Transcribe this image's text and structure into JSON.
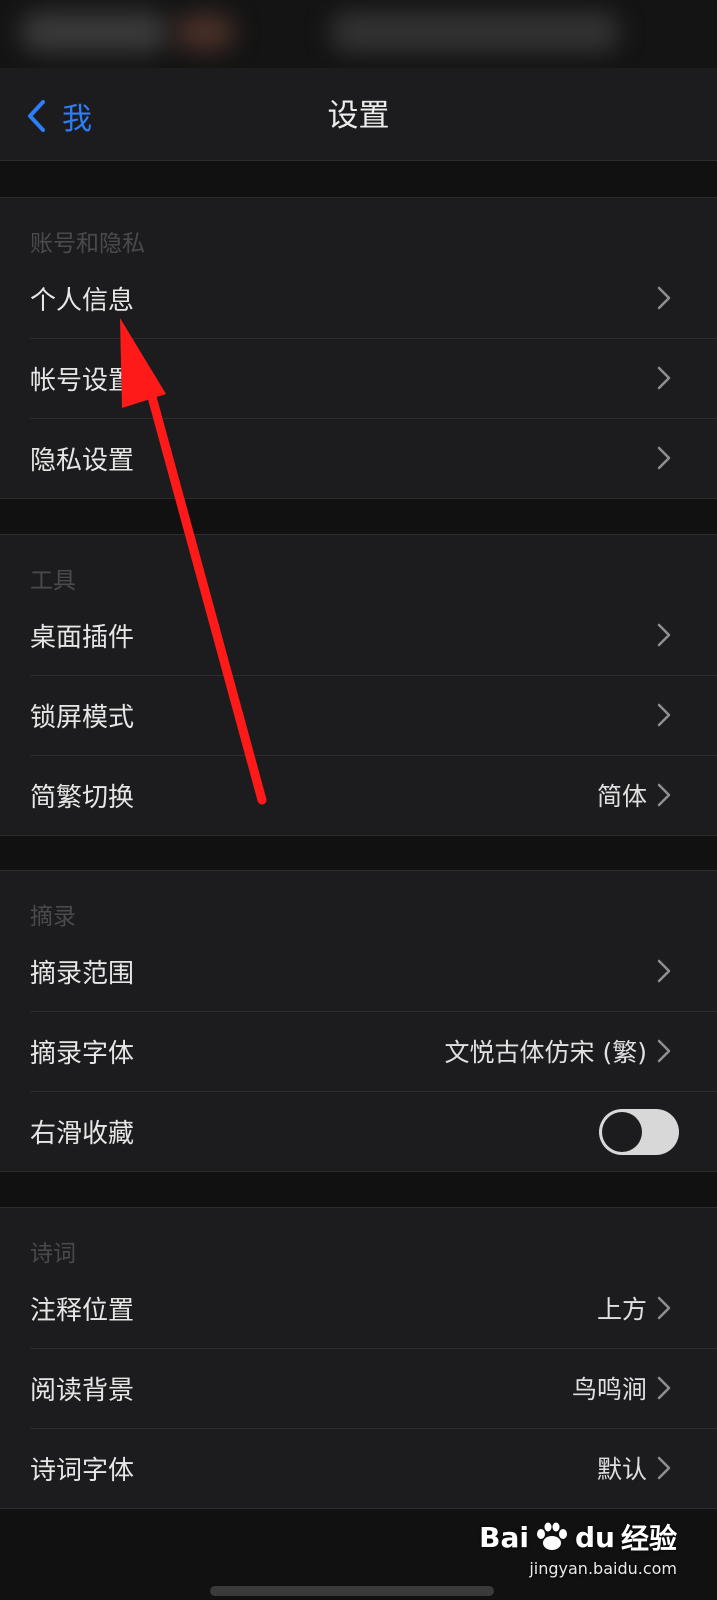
{
  "navbar": {
    "back_label": "我",
    "title": "设置"
  },
  "groups": [
    {
      "header": "账号和隐私",
      "rows": [
        {
          "label": "个人信息",
          "value": ""
        },
        {
          "label": "帐号设置",
          "value": ""
        },
        {
          "label": "隐私设置",
          "value": ""
        }
      ]
    },
    {
      "header": "工具",
      "rows": [
        {
          "label": "桌面插件",
          "value": ""
        },
        {
          "label": "锁屏模式",
          "value": ""
        },
        {
          "label": "简繁切换",
          "value": "简体"
        }
      ]
    },
    {
      "header": "摘录",
      "rows": [
        {
          "label": "摘录范围",
          "value": ""
        },
        {
          "label": "摘录字体",
          "value": "文悦古体仿宋 (繁)"
        },
        {
          "label": "右滑收藏",
          "toggle": "off"
        }
      ]
    },
    {
      "header": "诗词",
      "rows": [
        {
          "label": "注释位置",
          "value": "上方"
        },
        {
          "label": "阅读背景",
          "value": "鸟鸣涧"
        },
        {
          "label": "诗词字体",
          "value": "默认"
        }
      ]
    }
  ],
  "watermark": {
    "brand_left": "Bai",
    "brand_mid": "du",
    "brand_right": "经验",
    "url": "jingyan.baidu.com"
  },
  "colors": {
    "accent": "#2b7ef6",
    "annotation_arrow": "#ff1a1a",
    "background": "#111111",
    "group_background": "#1c1c1e"
  }
}
